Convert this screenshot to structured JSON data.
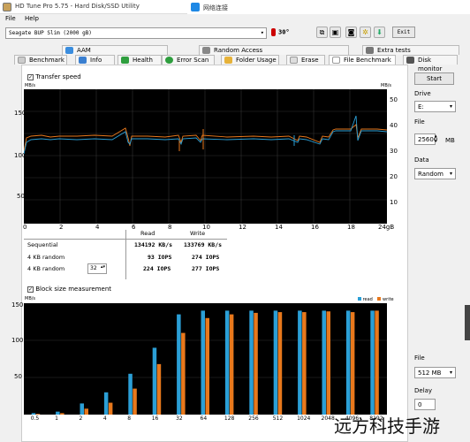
{
  "titlebar": {
    "title": "HD Tune Pro 5.75 - Hard Disk/SSD Utility",
    "other_title": "网络连接"
  },
  "menu": {
    "file": "File",
    "help": "Help"
  },
  "toolbar": {
    "disk": "Seagate BUP Slim (2000 gB)",
    "temp": "30°",
    "exit": "Exit"
  },
  "tabs_top": [
    "AAM",
    "Random Access",
    "Extra tests"
  ],
  "tabs_bottom": [
    "Benchmark",
    "Info",
    "Health",
    "Error Scan",
    "Folder Usage",
    "Erase",
    "File Benchmark",
    "Disk monitor"
  ],
  "transfer": {
    "label": "Transfer speed",
    "yunit": "MB/s",
    "yunit_right": "MB/s",
    "yticks_left": [
      "150",
      "100",
      "50"
    ],
    "yticks_right": [
      "50",
      "40",
      "30",
      "20",
      "10"
    ],
    "xticks": [
      "0",
      "2",
      "4",
      "6",
      "8",
      "10",
      "12",
      "14",
      "16",
      "18",
      "20",
      "22",
      "24gB"
    ]
  },
  "results": {
    "header_read": "Read",
    "header_write": "Write",
    "rows": [
      {
        "label": "Sequential",
        "read": "134192 KB/s",
        "write": "133769 KB/s"
      },
      {
        "label": "4 KB random",
        "read": "93 IOPS",
        "write": "274 IOPS"
      },
      {
        "label": "4 KB random",
        "read": "224 IOPS",
        "write": "277 IOPS",
        "qd": "32"
      }
    ]
  },
  "block": {
    "label": "Block size measurement",
    "yunit": "MB/s",
    "legend_read": "read",
    "legend_write": "write",
    "yticks": [
      "150",
      "100",
      "50"
    ]
  },
  "chart_data": {
    "type": "bar",
    "categories": [
      "0.5",
      "1",
      "2",
      "4",
      "8",
      "16",
      "32",
      "64",
      "128",
      "256",
      "512",
      "1024",
      "2048",
      "4096",
      "8192"
    ],
    "series": [
      {
        "name": "read",
        "values": [
          2,
          4,
          15,
          30,
          55,
          90,
          135,
          140,
          140,
          140,
          140,
          140,
          140,
          140,
          140
        ]
      },
      {
        "name": "write",
        "values": [
          1,
          2,
          8,
          16,
          35,
          68,
          110,
          130,
          135,
          137,
          138,
          138,
          139,
          138,
          140
        ]
      }
    ],
    "ylim": [
      0,
      150
    ],
    "ylabel": "MB/s",
    "colors": {
      "read": "#2b9fd6",
      "write": "#e8781c"
    }
  },
  "side": {
    "start": "Start",
    "drive_label": "Drive",
    "drive_value": "E:",
    "file_label": "File",
    "file_value": "25600",
    "file_unit": "MB",
    "data_label": "Data",
    "data_value": "Random",
    "file2_label": "File",
    "file2_value": "512 MB",
    "delay_label": "Delay",
    "delay_value": "0"
  },
  "watermark": "远方科技手游"
}
